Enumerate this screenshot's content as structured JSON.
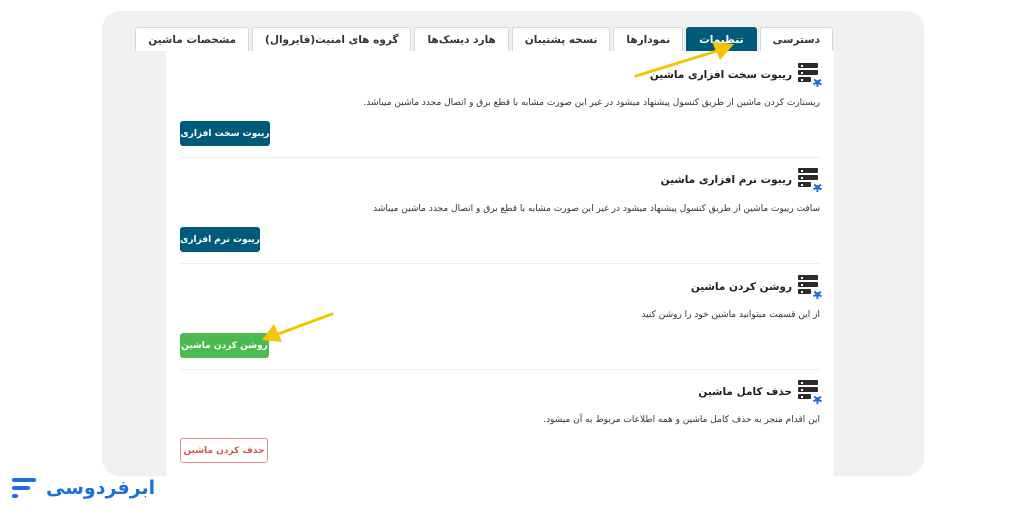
{
  "tabs": [
    {
      "label": "دسترسی",
      "active": false
    },
    {
      "label": "تنظیمات",
      "active": true
    },
    {
      "label": "نمودارها",
      "active": false
    },
    {
      "label": "نسخه پشتیبان",
      "active": false
    },
    {
      "label": "هارد دیسک‌ها",
      "active": false
    },
    {
      "label": "گروه های امنیت(فایروال)",
      "active": false
    },
    {
      "label": "مشخصات ماشین",
      "active": false
    }
  ],
  "sections": {
    "hard_reboot": {
      "title": "ریبوت سخت افزاری ماشین",
      "description": "ریستارت کردن ماشین از طریق کنسول پیشنهاد میشود در غیر این صورت مشابه با قطع برق و اتصال مجدد ماشین میباشد.",
      "button": "ریبوت سخت افزاری"
    },
    "soft_reboot": {
      "title": "ریبوت نرم افزاری ماشین",
      "description": "سافت ریبوت ماشین از طریق کنسول پیشنهاد میشود در غیر این صورت مشابه با قطع برق و اتصال مجدد ماشین میباشد",
      "button": "ریبوت نرم افزاری"
    },
    "power_on": {
      "title": "روشن کردن ماشین",
      "description": "از این قسمت میتوانید ماشین خود را روشن کنید",
      "button": "روشن کردن ماشین"
    },
    "delete": {
      "title": "حذف کامل ماشین",
      "description": "این اقدام منجر به حذف کامل ماشین و همه اطلاعات مربوط به آن میشود.",
      "button": "حذف کردن ماشین"
    }
  },
  "colors": {
    "primary": "#005b7a",
    "success": "#4cbb4f",
    "danger": "#d9534f",
    "arrow": "#f2c500",
    "brand": "#1e6fd9"
  },
  "brand": {
    "name": "ابرفردوسی"
  }
}
